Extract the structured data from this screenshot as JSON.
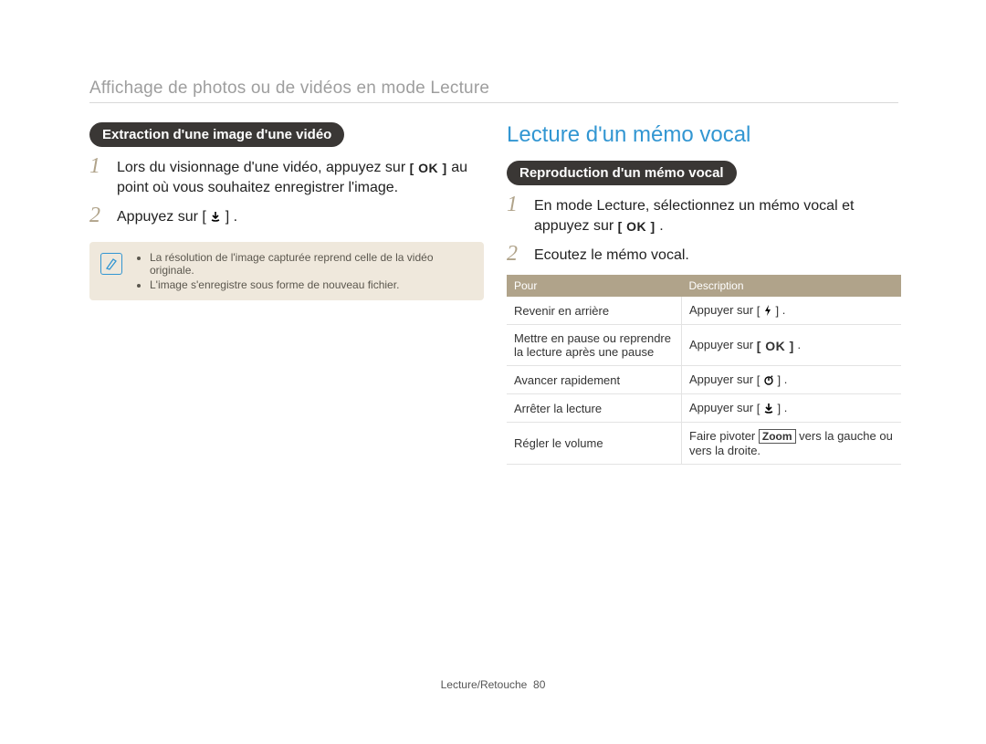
{
  "header": {
    "title": "Affichage de photos ou de vidéos en mode Lecture"
  },
  "left": {
    "pill": "Extraction d'une image d'une vidéo",
    "step1a": "Lors du visionnage d'une vidéo, appuyez sur ",
    "step1b": " au point où vous souhaitez enregistrer l'image.",
    "step2a": "Appuyez sur ",
    "step2b": ".",
    "note1": "La résolution de l'image capturée reprend celle de la vidéo originale.",
    "note2": "L'image s'enregistre sous forme de nouveau fichier."
  },
  "right": {
    "title": "Lecture d'un mémo vocal",
    "pill": "Reproduction d'un mémo vocal",
    "step1a": "En mode Lecture, sélectionnez un mémo vocal et appuyez sur ",
    "step1b": ".",
    "step2": "Ecoutez le mémo vocal.",
    "table": {
      "h1": "Pour",
      "h2": "Description",
      "rows": [
        {
          "l": "Revenir en arrière",
          "r_pre": "Appuyer sur ",
          "icon": "flash",
          "r_post": "."
        },
        {
          "l": "Mettre en pause ou reprendre la lecture après une pause",
          "r_pre": "Appuyer sur ",
          "icon": "ok",
          "r_post": "."
        },
        {
          "l": "Avancer rapidement",
          "r_pre": "Appuyer sur ",
          "icon": "timer",
          "r_post": "."
        },
        {
          "l": "Arrêter la lecture",
          "r_pre": "Appuyer sur ",
          "icon": "down",
          "r_post": "."
        },
        {
          "l": "Régler le volume",
          "r_pre": "Faire pivoter ",
          "zoom": "Zoom",
          "r_post": " vers la gauche ou vers la droite."
        }
      ]
    }
  },
  "footer": {
    "section": "Lecture/Retouche",
    "page": "80"
  }
}
